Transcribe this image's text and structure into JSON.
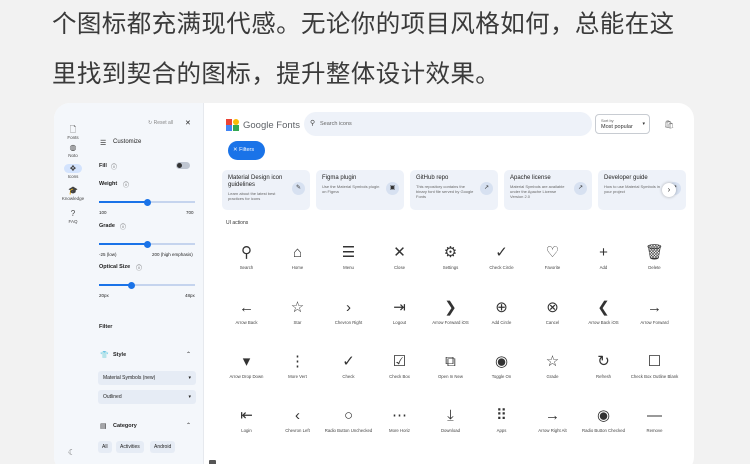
{
  "caption": {
    "line1": "个图标都充满现代感。无论你的项目风格如何，总能在这",
    "line2": "里找到契合的图标，提升整体设计效果。"
  },
  "rail": {
    "items": [
      {
        "label": "Fonts",
        "icon": "font-icon",
        "glyph": "🗋"
      },
      {
        "label": "Noto",
        "icon": "globe-icon",
        "glyph": "◍"
      },
      {
        "label": "Icons",
        "icon": "shapes-icon",
        "glyph": "❖",
        "active": true
      },
      {
        "label": "Knowledge",
        "icon": "school-icon",
        "glyph": "🎓"
      },
      {
        "label": "FAQ",
        "icon": "help-icon",
        "glyph": "?"
      }
    ],
    "theme_glyph": "☾"
  },
  "panel": {
    "reset": "Reset all",
    "close_glyph": "✕",
    "customize": "Customize",
    "fill_label": "Fill",
    "weight_label": "Weight",
    "weight_min": "100",
    "weight_max": "700",
    "grade_label": "Grade",
    "grade_min": "-25 (low)",
    "grade_max": "200 (high emphasis)",
    "optical_label": "Optical Size",
    "optical_min": "20px",
    "optical_max": "48px",
    "filter_label": "Filter",
    "style_label": "Style",
    "style_family": "Material Symbols (new)",
    "style_variant": "Outlined",
    "category_label": "Category",
    "chips": [
      "All",
      "Activities",
      "Android"
    ],
    "fill_level": 0,
    "weight_level": 0.5,
    "grade_level": 0.5,
    "optical_level": 0.33
  },
  "header": {
    "brand": "Google Fonts",
    "search_placeholder": "Search icons",
    "sort_label": "Sort by",
    "sort_value": "Most popular"
  },
  "filters_button": "Filters",
  "resources": [
    {
      "title": "Material Design icon guidelines",
      "desc": "Learn about the latest best practices for icons",
      "glyph": "✎"
    },
    {
      "title": "Figma plugin",
      "desc": "Use the Material Symbols plugin on Figma",
      "glyph": "▣"
    },
    {
      "title": "GitHub repo",
      "desc": "This repository contains the binary font file served by Google Fonts",
      "glyph": "↗"
    },
    {
      "title": "Apache license",
      "desc": "Material Symbols are available under the Apache License Version 2.0",
      "glyph": "↗"
    },
    {
      "title": "Developer guide",
      "desc": "How to use Material Symbols in your project",
      "glyph": "↗"
    }
  ],
  "section_label": "UI actions",
  "icons": [
    {
      "name": "Search",
      "glyph": "⚲"
    },
    {
      "name": "Home",
      "glyph": "⌂"
    },
    {
      "name": "Menu",
      "glyph": "☰"
    },
    {
      "name": "Close",
      "glyph": "✕"
    },
    {
      "name": "Settings",
      "glyph": "⚙"
    },
    {
      "name": "Check Circle",
      "glyph": "✓"
    },
    {
      "name": "Favorite",
      "glyph": "♡"
    },
    {
      "name": "Add",
      "glyph": "+"
    },
    {
      "name": "Delete",
      "glyph": "🗑"
    },
    {
      "name": "Arrow Back",
      "glyph": "←"
    },
    {
      "name": "Star",
      "glyph": "☆"
    },
    {
      "name": "Chevron Right",
      "glyph": "›"
    },
    {
      "name": "Logout",
      "glyph": "⇥"
    },
    {
      "name": "Arrow Forward iOS",
      "glyph": "❯"
    },
    {
      "name": "Add Circle",
      "glyph": "⊕"
    },
    {
      "name": "Cancel",
      "glyph": "⊗"
    },
    {
      "name": "Arrow Back iOS",
      "glyph": "❮"
    },
    {
      "name": "Arrow Forward",
      "glyph": "→"
    },
    {
      "name": "Arrow Drop Down",
      "glyph": "▾"
    },
    {
      "name": "More Vert",
      "glyph": "⋮"
    },
    {
      "name": "Check",
      "glyph": "✓"
    },
    {
      "name": "Check Box",
      "glyph": "☑"
    },
    {
      "name": "Open In New",
      "glyph": "⧉"
    },
    {
      "name": "Toggle On",
      "glyph": "◉"
    },
    {
      "name": "Grade",
      "glyph": "☆"
    },
    {
      "name": "Refresh",
      "glyph": "↻"
    },
    {
      "name": "Check Box Outline Blank",
      "glyph": "☐"
    },
    {
      "name": "Login",
      "glyph": "⇤"
    },
    {
      "name": "Chevron Left",
      "glyph": "‹"
    },
    {
      "name": "Radio Button Unchecked",
      "glyph": "○"
    },
    {
      "name": "More Horiz",
      "glyph": "⋯"
    },
    {
      "name": "Download",
      "glyph": "⤓"
    },
    {
      "name": "Apps",
      "glyph": "⠿"
    },
    {
      "name": "Arrow Right Alt",
      "glyph": "→"
    },
    {
      "name": "Radio Button Checked",
      "glyph": "◉"
    },
    {
      "name": "Remove",
      "glyph": "—"
    }
  ],
  "colors": {
    "accent": "#1a73e8",
    "panel_bg": "#f4f7fb",
    "card_bg": "#eef2f9"
  }
}
